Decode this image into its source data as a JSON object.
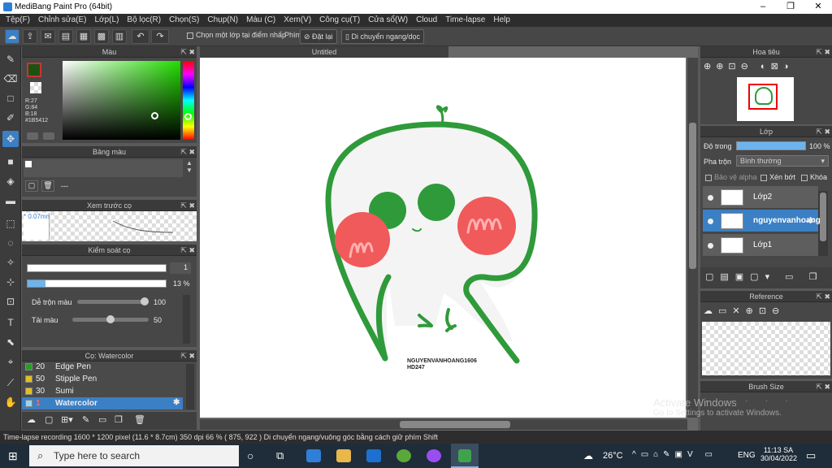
{
  "window": {
    "title": "MediBang Paint Pro (64bit)",
    "minimize": "–",
    "maximize": "❐",
    "close": "✕"
  },
  "menu": [
    "Tệp(F)",
    "Chỉnh sửa(E)",
    "Lớp(L)",
    "Bộ lọc(R)",
    "Chọn(S)",
    "Chụp(N)",
    "Màu (C)",
    "Xem(V)",
    "Công cụ(T)",
    "Cửa sổ(W)",
    "Cloud",
    "Time-lapse",
    "Help"
  ],
  "toolbar": {
    "select_one_layer": "Chọn một lớp tại điểm nhấp",
    "key_label": "Phím",
    "reset": "Đặt lại",
    "move_hv": "Di chuyển ngang/dọc"
  },
  "color_panel": {
    "title": "Màu",
    "r": "R:27",
    "g": "G:84",
    "b": "B:18",
    "hex": "#1B5412",
    "main_color": "#1b5412"
  },
  "palette_panel": {
    "title": "Bảng màu",
    "dash": "---"
  },
  "brush_preview": {
    "title": "Xem trước cọ",
    "size": "0.07mm"
  },
  "brush_control": {
    "title": "Kiểm soát cọ",
    "size_value": "1",
    "opacity_value": "13 %",
    "blend_label": "Dễ trộn màu",
    "blend_value": "100",
    "load_label": "Tải màu",
    "load_value": "50",
    "opacity_fraction": 0.13,
    "blend_fraction": 1.0,
    "load_fraction": 0.5
  },
  "brush_list": {
    "title": "Cọ: Watercolor",
    "items": [
      {
        "size": "20",
        "name": "Edge Pen",
        "color": "#2a9a2a"
      },
      {
        "size": "50",
        "name": "Stipple Pen",
        "color": "#e0c020"
      },
      {
        "size": "30",
        "name": "Sumi",
        "color": "#e0c020"
      },
      {
        "size": "1",
        "name": "Watercolor",
        "color": "#9ad4f0"
      }
    ]
  },
  "document": {
    "tab": "Untitled",
    "signature_line1": "NGUYENVANHOANG1606",
    "signature_line2": "HD247"
  },
  "navigator": {
    "title": "Hoa tiêu"
  },
  "layers_panel": {
    "title": "Lớp",
    "opacity_label": "Độ trong",
    "opacity_value": "100 %",
    "blend_label": "Pha trộn",
    "blend_value": "Bình thường",
    "protect_alpha": "Bảo vệ alpha",
    "clipping": "Xén bớt",
    "lock": "Khóa",
    "layers": [
      {
        "name": "Lớp2",
        "selected": false
      },
      {
        "name": "nguyenvanhoang",
        "selected": true
      },
      {
        "name": "Lớp1",
        "selected": false
      }
    ]
  },
  "reference_panel": {
    "title": "Reference"
  },
  "brush_size_panel": {
    "title": "Brush Size"
  },
  "status": {
    "text": "Time-lapse recording   1600 * 1200 pixel   (11.6 * 8.7cm)   350 dpi   66 %   ( 875, 922 )   Di chuyển ngang/vuông góc bằng cách giữ phím Shift"
  },
  "watermark": {
    "line1": "Activate Windows",
    "line2": "Go to Settings to activate Windows."
  },
  "taskbar": {
    "search_placeholder": "Type here to search",
    "weather": "26°C",
    "lang": "ENG",
    "time": "11:13 SA",
    "date": "30/04/2022"
  }
}
